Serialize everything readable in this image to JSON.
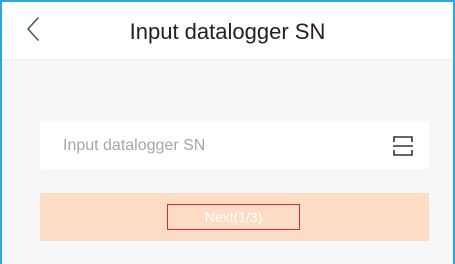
{
  "header": {
    "title": "Input datalogger SN",
    "back_icon": "chevron-left-icon"
  },
  "form": {
    "sn_placeholder": "Input datalogger SN",
    "sn_value": "",
    "scan_icon": "scan-icon"
  },
  "actions": {
    "next_label": "Next(1/3)"
  },
  "colors": {
    "accent_frame": "#2aa7e8",
    "button_bg": "#fcdcc4",
    "highlight_border": "#e0282e",
    "page_bg": "#f7f7f7"
  }
}
